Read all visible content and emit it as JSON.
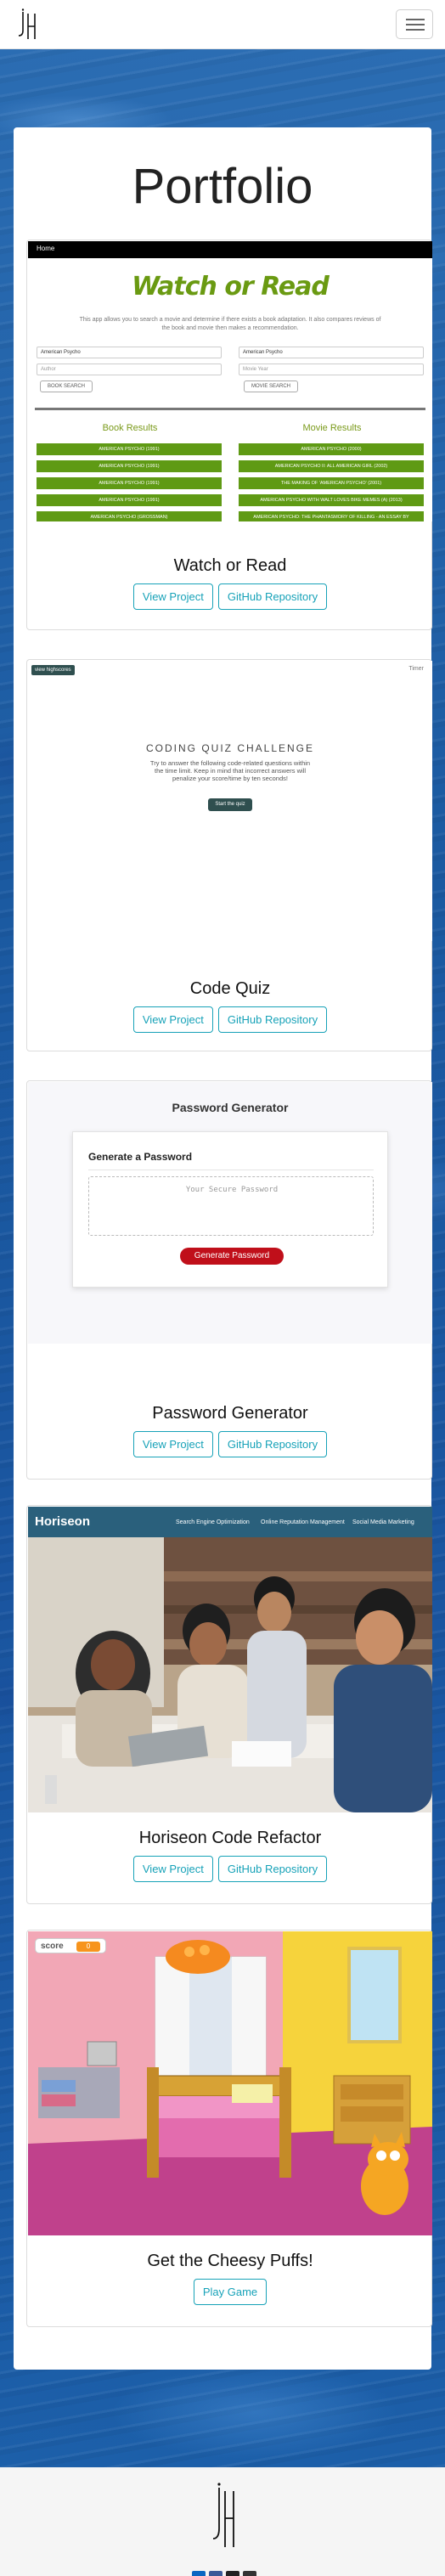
{
  "page": {
    "title": "Portfolio"
  },
  "navbar": {
    "logo_text": "jH",
    "menu_icon": "hamburger-icon"
  },
  "projects": [
    {
      "title": "Watch or Read",
      "buttons": [
        "View Project",
        "GitHub Repository"
      ],
      "preview": {
        "nav_item": "Home",
        "logo": "Watch or Read",
        "description": "This app allows you to search a movie and determine if there exists a book adaptation. It also compares reviews of the book and movie then makes a recommendation.",
        "book_input": "American Psycho",
        "author_placeholder": "Author",
        "book_button": "BOOK SEARCH",
        "movie_input": "American Psycho",
        "year_placeholder": "Movie Year",
        "movie_button": "MOVIE SEARCH",
        "book_results_heading": "Book Results",
        "movie_results_heading": "Movie Results",
        "book_results": [
          "AMERICAN PSYCHO (1991)",
          "AMERICAN PSYCHO (1991)",
          "AMERICAN PSYCHO (1991)",
          "AMERICAN PSYCHO (1991)",
          "AMERICAN PSYCHO (GROSSMAN)"
        ],
        "movie_results": [
          "AMERICAN PSYCHO (2000)",
          "AMERICAN PSYCHO II: ALL AMERICAN GIRL (2002)",
          "THE MAKING OF 'AMERICAN PSYCHO' (2001)",
          "AMERICAN PSYCHO WITH WALT LOVES BIKE MEMES (A) (2013)",
          "AMERICAN PSYCHO: THE PHANTASMORY OF KILLING - AN ESSAY BY"
        ]
      }
    },
    {
      "title": "Code Quiz",
      "buttons": [
        "View Project",
        "GitHub Repository"
      ],
      "preview": {
        "tag": "view highscores",
        "timer": "Timer",
        "heading": "CODING QUIZ CHALLENGE",
        "description": "Try to answer the following code-related questions within the time limit. Keep in mind that incorrect answers will penalize your score/time by ten seconds!",
        "start_button": "Start the quiz"
      }
    },
    {
      "title": "Password Generator",
      "buttons": [
        "View Project",
        "GitHub Repository"
      ],
      "preview": {
        "heading": "Password Generator",
        "card_title": "Generate a Password",
        "placeholder": "Your Secure Password",
        "button": "Generate Password"
      }
    },
    {
      "title": "Horiseon Code Refactor",
      "buttons": [
        "View Project",
        "GitHub Repository"
      ],
      "preview": {
        "brand": "Horiseon",
        "nav": [
          "Search Engine Optimization",
          "Online Reputation Management",
          "Social Media Marketing"
        ]
      }
    },
    {
      "title": "Get the Cheesy Puffs!",
      "buttons": [
        "Play Game"
      ],
      "preview": {
        "score_label": "score",
        "score_value": "0"
      }
    }
  ],
  "footer": {
    "logo_text": "jH",
    "social": [
      "linkedin-icon",
      "facebook-icon",
      "github-icon",
      "email-icon"
    ],
    "colors": {
      "brand_button": "#17a2b8",
      "accent_green": "#5f9a14",
      "password_red": "#c00f1a",
      "horiseon_teal": "#2a607c"
    }
  }
}
